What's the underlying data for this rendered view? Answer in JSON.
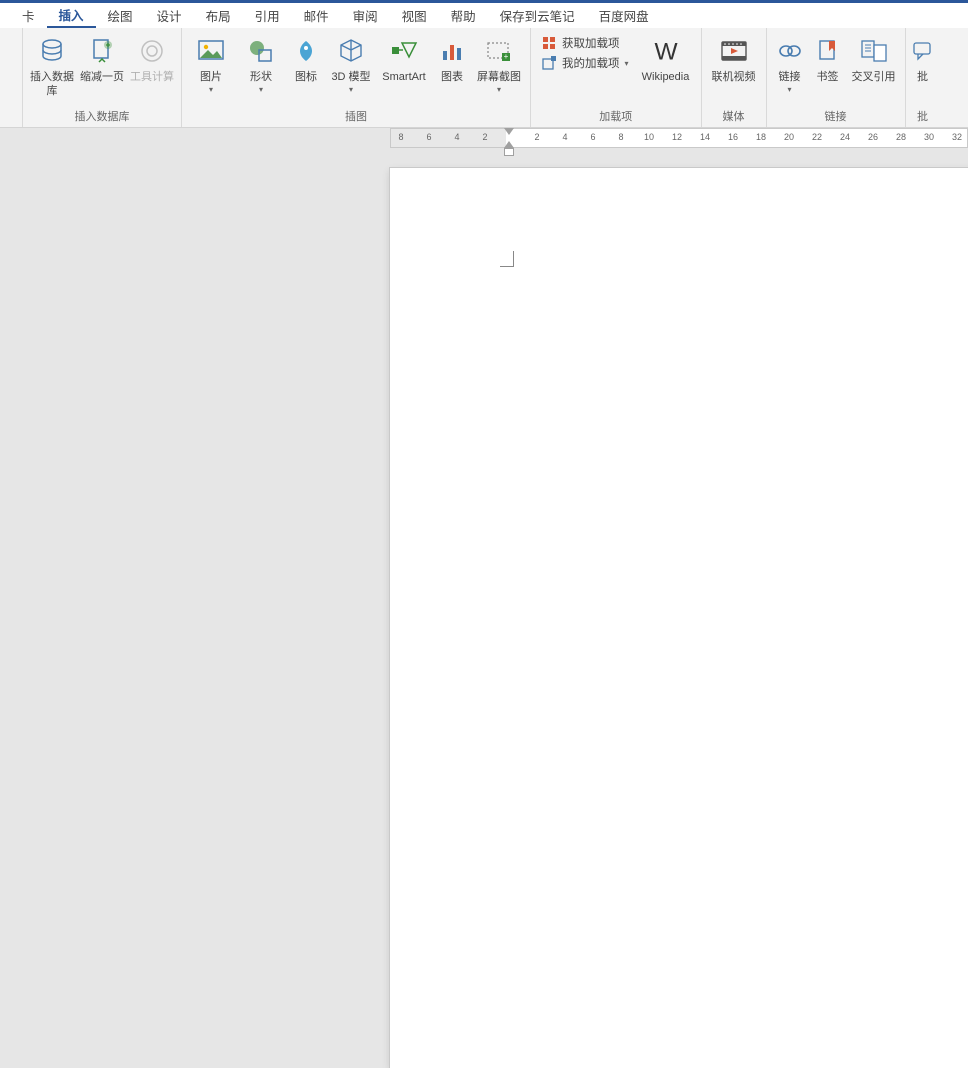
{
  "tabs": {
    "partial": "卡",
    "insert": "插入",
    "draw": "绘图",
    "design": "设计",
    "layout": "布局",
    "references": "引用",
    "mailings": "邮件",
    "review": "审阅",
    "view": "视图",
    "help": "帮助",
    "save_cloud": "保存到云笔记",
    "baidu": "百度网盘"
  },
  "groups": {
    "database": "插入数据库",
    "illustrations": "插图",
    "addins": "加载项",
    "media": "媒体",
    "links": "链接",
    "comments_partial": "批"
  },
  "btn": {
    "insert_db": "插入数据库",
    "shrink_page": "缩减一页",
    "tool_calc": "工具计算",
    "picture": "图片",
    "shapes": "形状",
    "icons": "图标",
    "model3d": "3D 模型",
    "smartart": "SmartArt",
    "chart": "图表",
    "screenshot": "屏幕截图",
    "get_addins": "获取加载项",
    "my_addins": "我的加载项",
    "wikipedia": "Wikipedia",
    "online_video": "联机视频",
    "link": "链接",
    "bookmark": "书签",
    "cross_ref": "交叉引用",
    "comment_partial": "批"
  },
  "ruler": {
    "left_ticks": [
      "8",
      "6",
      "4",
      "2"
    ],
    "right_ticks": [
      "2",
      "4",
      "6",
      "8",
      "10",
      "12",
      "14",
      "16",
      "18",
      "20",
      "22",
      "24",
      "26",
      "28",
      "30",
      "32"
    ]
  }
}
